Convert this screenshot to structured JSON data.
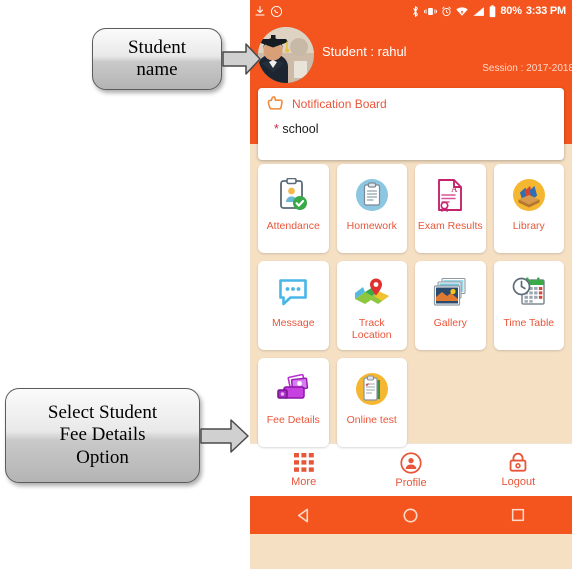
{
  "statusbar": {
    "left_icons": [
      "download-icon",
      "whatsapp-icon"
    ],
    "right_icons": [
      "bluetooth-icon",
      "vibrate-icon",
      "alarm-icon",
      "wifi-icon",
      "signal-icon",
      "battery-icon"
    ],
    "battery_percent": "80%",
    "time": "3:33 PM"
  },
  "header": {
    "avatar": "student-photo",
    "student_label": "Student : rahul",
    "session_label": "Session : 2017-2018",
    "bg_color": "#f4551e"
  },
  "notification": {
    "icon": "pointing-hand-icon",
    "title": "Notification Board",
    "bullet": "*",
    "items": [
      "school"
    ]
  },
  "grid": {
    "bg_color": "#f5e0c4",
    "label_color": "#e8563a",
    "tiles": [
      {
        "label": "Attendance",
        "icon": "attendance-icon"
      },
      {
        "label": "Homework",
        "icon": "homework-icon"
      },
      {
        "label": "Exam Results",
        "icon": "exam-results-icon"
      },
      {
        "label": "Library",
        "icon": "library-icon"
      },
      {
        "label": "Message",
        "icon": "message-icon"
      },
      {
        "label": "Track Location",
        "icon": "track-location-icon"
      },
      {
        "label": "Gallery",
        "icon": "gallery-icon"
      },
      {
        "label": "Time Table",
        "icon": "time-table-icon"
      },
      {
        "label": "Fee Details",
        "icon": "fee-details-icon"
      },
      {
        "label": "Online test",
        "icon": "online-test-icon"
      }
    ]
  },
  "bottom_nav": {
    "items": [
      {
        "label": "More",
        "icon": "grid-icon"
      },
      {
        "label": "Profile",
        "icon": "person-circle-icon"
      },
      {
        "label": "Logout",
        "icon": "lock-icon"
      }
    ]
  },
  "android_nav": {
    "back": "back-triangle-icon",
    "home": "home-circle-icon",
    "recents": "recents-square-icon"
  },
  "annotations": [
    {
      "id": "student-name",
      "lines": [
        "Student",
        "name"
      ],
      "arrow": "right-arrow"
    },
    {
      "id": "fee-details",
      "lines": [
        "Select Student",
        "Fee Details",
        "Option"
      ],
      "arrow": "right-arrow"
    }
  ]
}
